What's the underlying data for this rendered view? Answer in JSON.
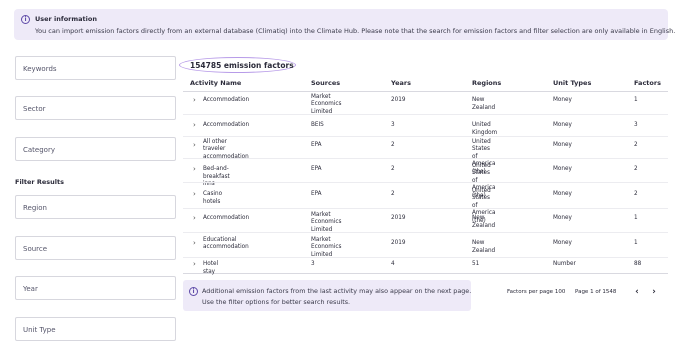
{
  "banner": {
    "icon": "info-icon",
    "title": "User information",
    "message": "You can import emission factors directly from an external database (Climatiq) into the Climate Hub. Please note that the search for emission factors and filter selection are only available in English."
  },
  "filters": {
    "keywords": "Keywords",
    "sector": "Sector",
    "category": "Category",
    "heading": "Filter Results",
    "region": "Region",
    "source": "Source",
    "year": "Year",
    "unit_type": "Unit Type"
  },
  "results": {
    "count_label": "154785 emission factors"
  },
  "table": {
    "headers": [
      "Activity Name",
      "Sources",
      "Years",
      "Regions",
      "Unit Types",
      "Factors"
    ],
    "rows": [
      {
        "activity": [
          "Accommodation"
        ],
        "source": [
          "Market Economics",
          "Limited"
        ],
        "year": "2019",
        "region": [
          "New Zealand"
        ],
        "unit": "Money",
        "factors": "1"
      },
      {
        "activity": [
          "Accommodation"
        ],
        "source": [
          "BEIS"
        ],
        "year": "3",
        "region": [
          "United Kingdom"
        ],
        "unit": "Money",
        "factors": "3"
      },
      {
        "activity": [
          "All other traveler",
          "accommodation"
        ],
        "source": [
          "EPA"
        ],
        "year": "2",
        "region": [
          "United States of",
          "America (the)"
        ],
        "unit": "Money",
        "factors": "2"
      },
      {
        "activity": [
          "Bed-and-breakfast inns"
        ],
        "source": [
          "EPA"
        ],
        "year": "2",
        "region": [
          "United States of",
          "America (the)"
        ],
        "unit": "Money",
        "factors": "2"
      },
      {
        "activity": [
          "Casino hotels"
        ],
        "source": [
          "EPA"
        ],
        "year": "2",
        "region": [
          "United States of",
          "America (the)"
        ],
        "unit": "Money",
        "factors": "2"
      },
      {
        "activity": [
          "Accommodation"
        ],
        "source": [
          "Market Economics",
          "Limited"
        ],
        "year": "2019",
        "region": [
          "New Zealand"
        ],
        "unit": "Money",
        "factors": "1"
      },
      {
        "activity": [
          "Educational",
          "accommodation"
        ],
        "source": [
          "Market Economics",
          "Limited"
        ],
        "year": "2019",
        "region": [
          "New Zealand"
        ],
        "unit": "Money",
        "factors": "1"
      },
      {
        "activity": [
          "Hotel stay"
        ],
        "source": [
          "3"
        ],
        "year": "4",
        "region": [
          "51"
        ],
        "unit": "Number",
        "factors": "88"
      }
    ]
  },
  "notice": {
    "icon": "info-icon",
    "line1": "Additional emission factors from the last activity may also appear on the next page.",
    "line2": "Use the filter options for better search results."
  },
  "pagination": {
    "per_page_label": "Factors per page",
    "per_page_value": "100",
    "page_label": "Page",
    "current_page": "1",
    "of_label": "of",
    "total_pages": "1548",
    "prev_icon": "chevron-left-icon",
    "next_icon": "chevron-right-icon"
  }
}
